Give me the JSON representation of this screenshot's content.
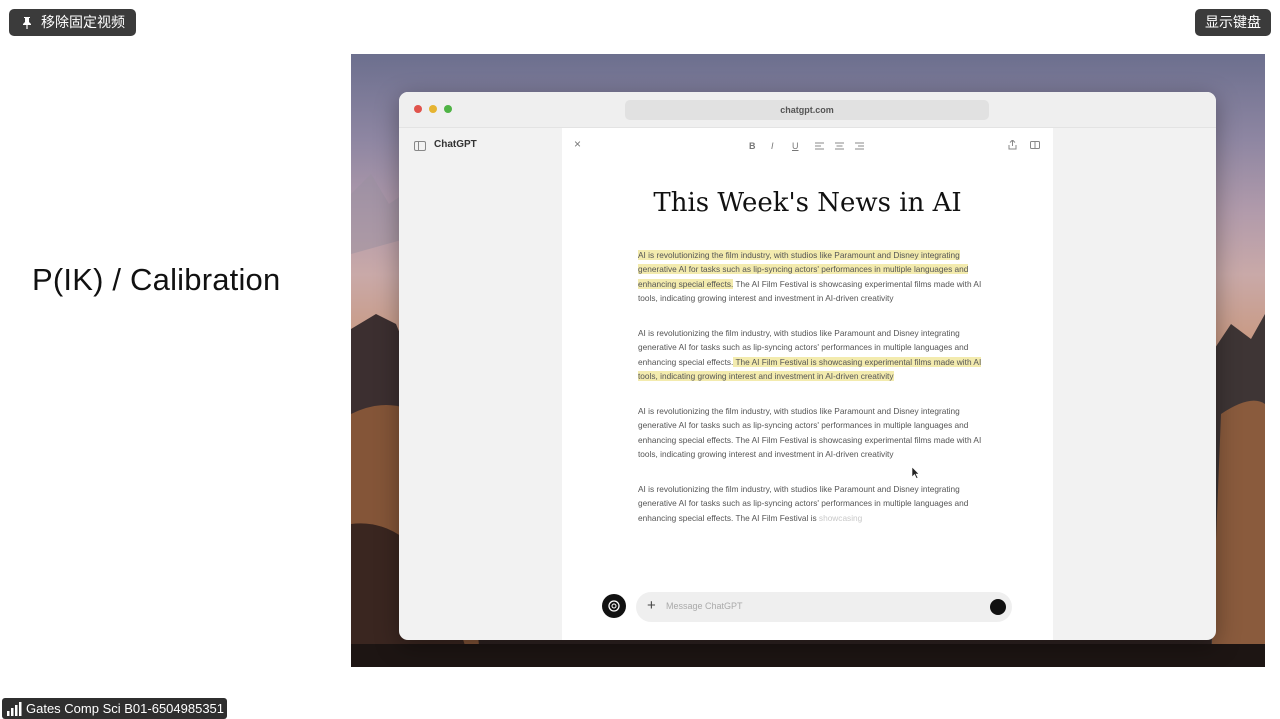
{
  "overlay": {
    "unpin_label": "移除固定视频",
    "keyboard_label": "显示键盘",
    "meeting_name": "Gates Comp Sci B01-6504985351"
  },
  "slide": {
    "title": "P(IK) / Calibration"
  },
  "browser": {
    "url": "chatgpt.com",
    "sidebar_brand": "ChatGPT",
    "toolbar": {
      "bold": "B",
      "italic": "I",
      "underline": "U"
    },
    "document": {
      "title": "This Week's News in AI",
      "paragraph_1": {
        "highlighted": "AI is revolutionizing the film industry, with studios like Paramount and Disney integrating generative AI for tasks such as lip-syncing actors' performances in multiple languages and enhancing special effects.",
        "plain": " The AI Film Festival is showcasing experimental films made with AI tools, indicating growing interest and investment in AI-driven creativity"
      },
      "paragraph_2": {
        "plain": "AI is revolutionizing the film industry, with studios like Paramount and Disney integrating generative AI for tasks such as lip-syncing actors' performances in multiple languages and enhancing special effects.",
        "highlighted": " The AI Film Festival is showcasing experimental films made with AI tools, indicating growing interest and investment in AI-driven creativity"
      },
      "paragraph_3": "AI is revolutionizing the film industry, with studios like Paramount and Disney integrating generative AI for tasks such as lip-syncing actors' performances in multiple languages and enhancing special effects. The AI Film Festival is showcasing experimental films made with AI tools, indicating growing interest and investment in AI-driven creativity",
      "paragraph_4": {
        "plain": "AI is revolutionizing the film industry, with studios like Paramount and Disney integrating generative AI for tasks such as lip-syncing actors' performances in multiple languages and enhancing special effects. The AI Film Festival is",
        "fading": " showcasing"
      }
    },
    "composer": {
      "placeholder": "Message ChatGPT",
      "plus": "+"
    }
  },
  "colors": {
    "highlight": "#f3ebae",
    "overlay_pill": "#3b3b3b"
  }
}
